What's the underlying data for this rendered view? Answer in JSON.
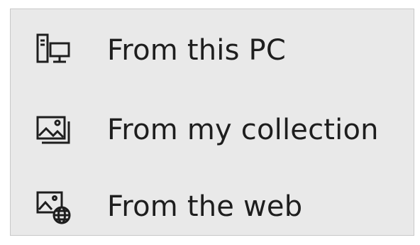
{
  "menu": {
    "items": [
      {
        "label": "From this PC",
        "icon": "computer-icon"
      },
      {
        "label": "From my collection",
        "icon": "photos-icon"
      },
      {
        "label": "From the web",
        "icon": "web-image-icon"
      }
    ]
  }
}
